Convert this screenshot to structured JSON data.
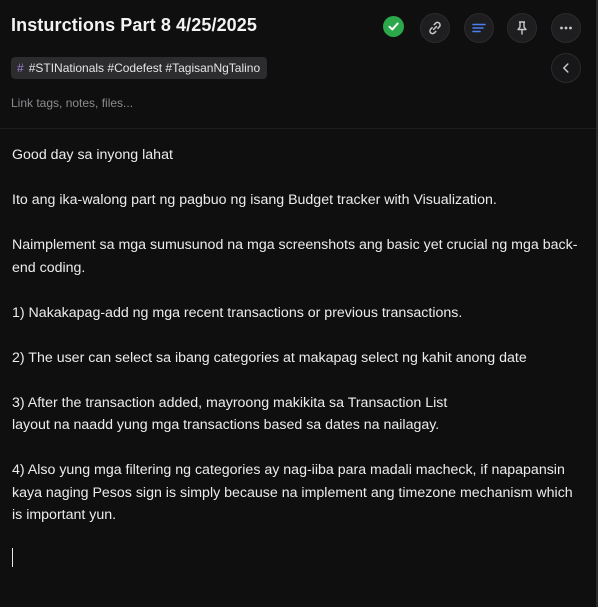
{
  "note": {
    "title": "Insturctions Part 8 4/25/2025",
    "tags_text": "#STINationals #Codefest #TagisanNgTalino",
    "tag_icon": "#",
    "link_placeholder": "Link tags, notes, files..."
  },
  "toolbar": {
    "status_icon": "check-circle-icon",
    "buttons": [
      "link-icon",
      "list-icon",
      "pin-icon",
      "more-icon"
    ],
    "accent_blue": "#4a7ef2",
    "status_green": "#2aa84a"
  },
  "content": {
    "p1": "Good day sa inyong lahat",
    "p2": "Ito ang ika-walong part ng pagbuo ng isang Budget tracker with Visualization.",
    "p3": "Naimplement sa mga sumusunod na mga screenshots ang basic yet crucial ng mga back-end coding.",
    "p4": "1) Nakakapag-add ng mga recent transactions or previous transactions.",
    "p5": "2) The user can select sa ibang categories at makapag select ng kahit anong date",
    "p6a": "3) After the transaction added, mayroong makikita sa Transaction List",
    "p6b": "layout na naadd yung mga transactions based sa dates na nailagay.",
    "p7": "4) Also yung mga filtering ng categories ay nag-iiba para madali macheck, if napapansin kaya naging Pesos sign is simply because na implement ang timezone mechanism which is important yun."
  }
}
